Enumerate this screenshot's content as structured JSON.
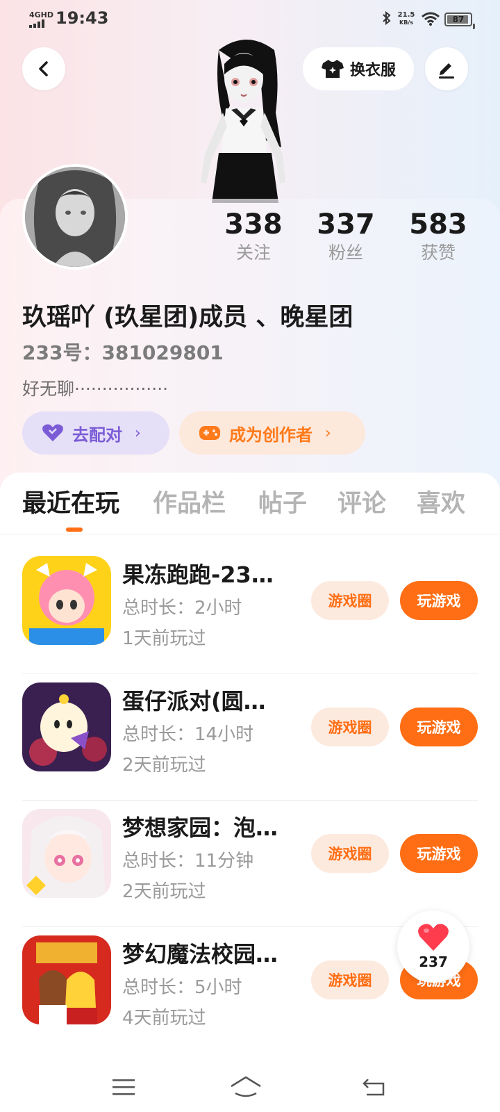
{
  "status_bar": {
    "network": "4GHD",
    "time": "19:43",
    "speed_value": "21.5",
    "speed_unit": "KB/s",
    "battery": "87"
  },
  "header": {
    "outfit_label": "换衣服"
  },
  "profile": {
    "stats": [
      {
        "value": "338",
        "label": "关注"
      },
      {
        "value": "337",
        "label": "粉丝"
      },
      {
        "value": "583",
        "label": "获赞"
      }
    ],
    "nickname": "玖瑶吖 (玖星团)成员 、晚星团",
    "user_id": "233号：381029801",
    "bio": "好无聊·················",
    "match_label": "去配对",
    "creator_label": "成为创作者"
  },
  "tabs": [
    "最近在玩",
    "作品栏",
    "帖子",
    "评论",
    "喜欢"
  ],
  "games": [
    {
      "name": "果冻跑跑-23…",
      "duration": "总时长：2小时",
      "last_played": "1天前玩过",
      "circle_label": "游戏圈",
      "play_label": "玩游戏"
    },
    {
      "name": "蛋仔派对(圆…",
      "duration": "总时长：14小时",
      "last_played": "2天前玩过",
      "circle_label": "游戏圈",
      "play_label": "玩游戏"
    },
    {
      "name": "梦想家园：泡…",
      "duration": "总时长：11分钟",
      "last_played": "2天前玩过",
      "circle_label": "游戏圈",
      "play_label": "玩游戏"
    },
    {
      "name": "梦幻魔法校园…",
      "duration": "总时长：5小时",
      "last_played": "4天前玩过",
      "circle_label": "游戏圈",
      "play_label": "玩游戏"
    }
  ],
  "like_fab": {
    "count": "237"
  },
  "colors": {
    "accent": "#ff6e14",
    "match": "#7b5cd6",
    "heart": "#ff3b4e"
  }
}
